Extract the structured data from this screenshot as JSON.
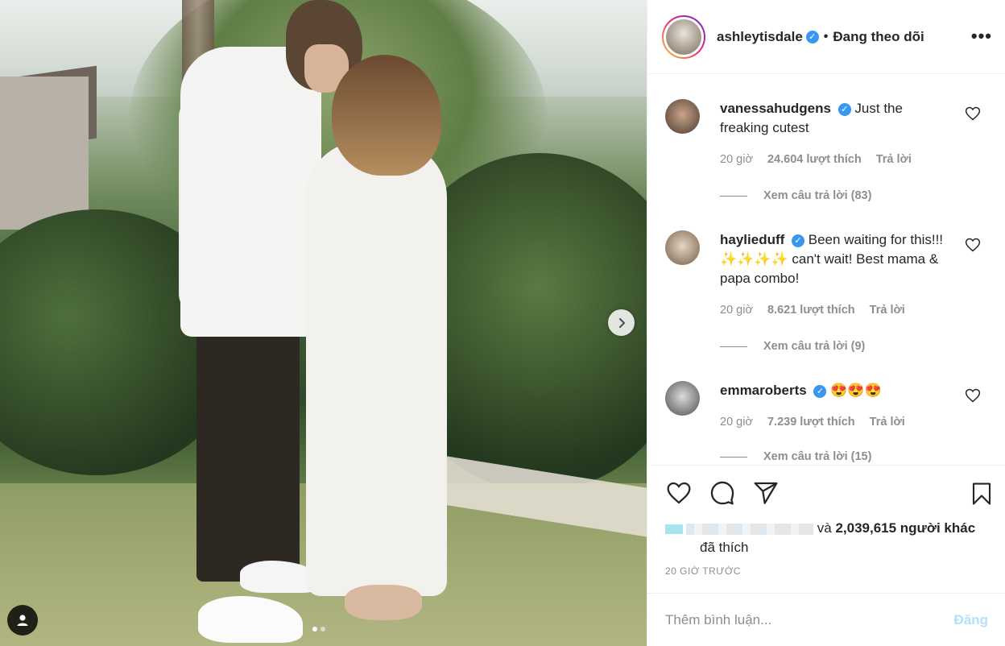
{
  "post": {
    "username": "ashleytisdale",
    "separator": "•",
    "follow_status": "Đang theo dõi",
    "more_label": "•••"
  },
  "comments": [
    {
      "user": "vanessahudgens",
      "text": "Just the freaking cutest",
      "time": "20 giờ",
      "likes": "24.604 lượt thích",
      "reply": "Trả lời",
      "view_replies": "Xem câu trả lời (83)"
    },
    {
      "user": "haylieduff",
      "text": "Been waiting for this!!! ✨✨✨✨ can't wait! Best mama & papa combo!",
      "time": "20 giờ",
      "likes": "8.621 lượt thích",
      "reply": "Trả lời",
      "view_replies": "Xem câu trả lời (9)"
    },
    {
      "user": "emmaroberts",
      "text": "😍😍😍",
      "time": "20 giờ",
      "likes": "7.239 lượt thích",
      "reply": "Trả lời",
      "view_replies": "Xem câu trả lời (15)"
    }
  ],
  "likes": {
    "conjunction": "và",
    "others": "2,039,615 người khác",
    "suffix": "đã thích"
  },
  "timestamp": "20 GIỜ TRƯỚC",
  "add_comment": {
    "placeholder": "Thêm bình luận...",
    "post_label": "Đăng"
  },
  "colors": {
    "accent": "#3897f0",
    "post_disabled": "#b2dffc",
    "muted": "#8e8e8e"
  },
  "icons": [
    "heart-icon",
    "comment-icon",
    "share-icon",
    "bookmark-icon",
    "chevron-right-icon",
    "user-tag-icon",
    "verified-icon",
    "more-icon"
  ]
}
